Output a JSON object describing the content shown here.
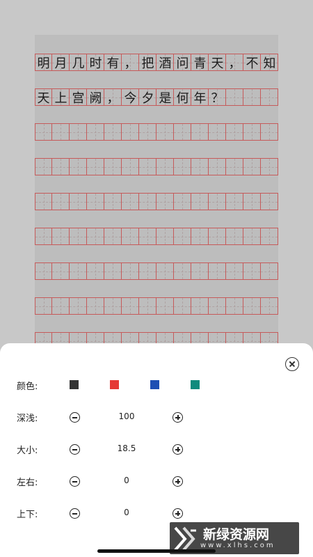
{
  "paper": {
    "line1": [
      "明",
      "月",
      "几",
      "时",
      "有",
      "，",
      "把",
      "酒",
      "问",
      "青",
      "天",
      "，",
      "不",
      "知"
    ],
    "line2": [
      "天",
      "上",
      "宫",
      "阙",
      "，",
      "今",
      "夕",
      "是",
      "何",
      "年",
      "？"
    ]
  },
  "settings": {
    "color_label": "颜色:",
    "colors": [
      "#333333",
      "#e53935",
      "#1e4fb3",
      "#0f8a7d"
    ],
    "depth_label": "深浅:",
    "depth_value": "100",
    "size_label": "大小:",
    "size_value": "18.5",
    "lr_label": "左右:",
    "lr_value": "0",
    "ud_label": "上下:",
    "ud_value": "0"
  },
  "watermark": {
    "text": "新绿资源网",
    "sub": "www.xlhs.com"
  }
}
